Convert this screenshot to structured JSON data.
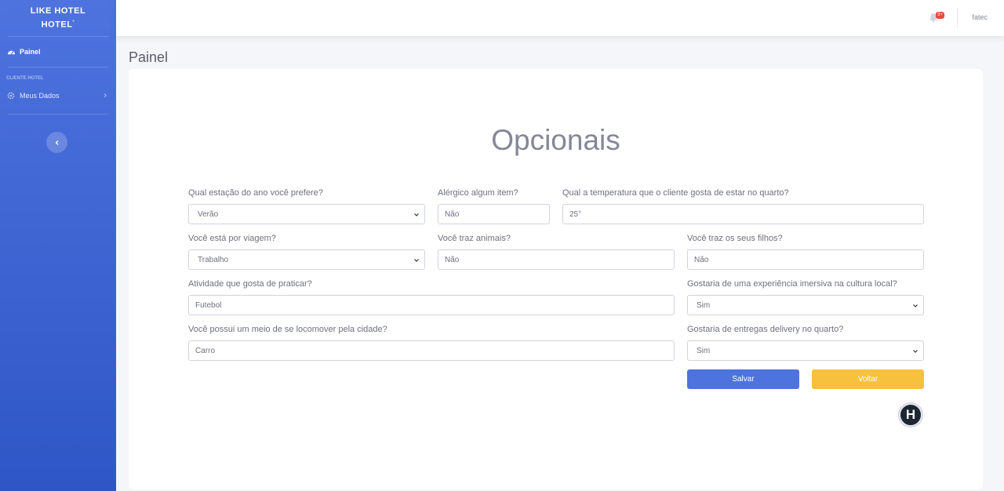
{
  "sidebar": {
    "brand_line1": "LIKE HOTEL",
    "brand_line2": "HOTEL",
    "brand_mark": "°",
    "active_item": "Painel",
    "section_heading": "CLIENTE HOTEL",
    "meus_dados": "Meus Dados"
  },
  "topbar": {
    "badge": "3+",
    "user": "fatec"
  },
  "page": {
    "title": "Painel",
    "heading": "Opcionais"
  },
  "form": {
    "estacao_label": "Qual estação do ano você prefere?",
    "estacao_value": "Verão",
    "alergico_label": "Alérgico algum item?",
    "alergico_value": "Não",
    "temperatura_label": "Qual a temperatura que o cliente gosta de estar no quarto?",
    "temperatura_value": "25°",
    "viagem_label": "Você está por viagem?",
    "viagem_value": "Trabalho",
    "animais_label": "Você traz animais?",
    "animais_value": "Não",
    "filhos_label": "Você traz os seus filhos?",
    "filhos_value": "Não",
    "atividade_label": "Atividade que gosta de praticar?",
    "atividade_value": "Futebol",
    "cultura_label": "Gostaria de uma experiência imersiva na cultura local?",
    "cultura_value": "Sim",
    "locomover_label": "Você possui um meio de se locomover pela cidade?",
    "locomover_value": "Carro",
    "delivery_label": "Gostaria de entregas delivery no quarto?",
    "delivery_value": "Sim"
  },
  "buttons": {
    "save": "Salvar",
    "back": "Voltar"
  },
  "logo_letter": "H",
  "colors": {
    "primary": "#4e73df",
    "warning": "#f6c23e",
    "danger": "#e74a3b"
  }
}
